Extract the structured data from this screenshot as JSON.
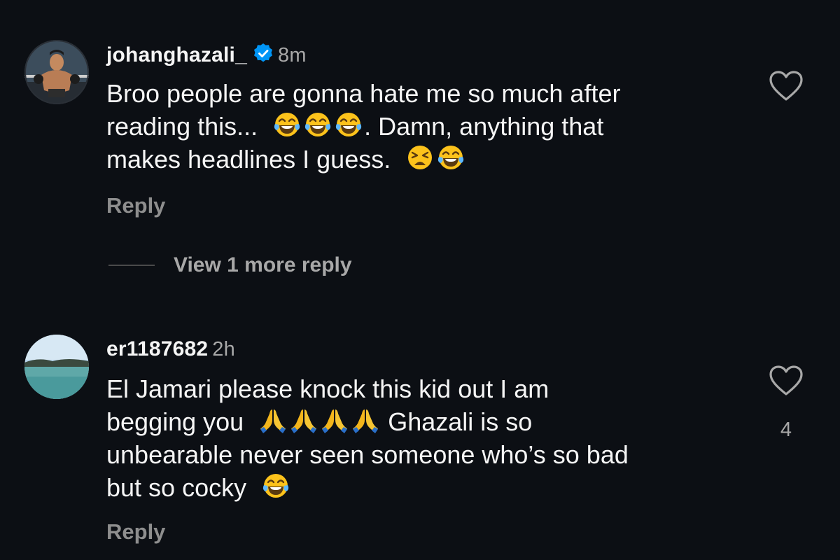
{
  "comments": [
    {
      "username": "johanghazali_",
      "verified": true,
      "time": "8m",
      "lines": [
        "Broo people are gonna hate me so much after",
        "reading this...",
        ". Damn, anything that",
        "makes headlines I guess."
      ],
      "emojis": [
        "tears-of-joy-emoji",
        "tears-of-joy-emoji",
        "tears-of-joy-emoji",
        "weary-face-emoji",
        "tears-of-joy-emoji"
      ],
      "reply_label": "Reply",
      "view_more_label": "View 1 more reply",
      "like_icon": "heart-outline-icon"
    },
    {
      "username": "er1187682",
      "verified": false,
      "time": "2h",
      "lines": [
        "El Jamari please knock this kid out I am",
        "begging you",
        "Ghazali is so",
        "unbearable never seen someone who’s so bad",
        "but so cocky"
      ],
      "emojis": [
        "folded-hands-emoji",
        "folded-hands-emoji",
        "folded-hands-emoji",
        "folded-hands-emoji",
        "tears-of-joy-emoji"
      ],
      "reply_label": "Reply",
      "like_icon": "heart-outline-icon",
      "like_count": "4"
    }
  ],
  "colors": {
    "background": "#0c0f14",
    "text": "#f5f5f5",
    "muted": "#a8a8a8",
    "verified": "#0095f6"
  }
}
